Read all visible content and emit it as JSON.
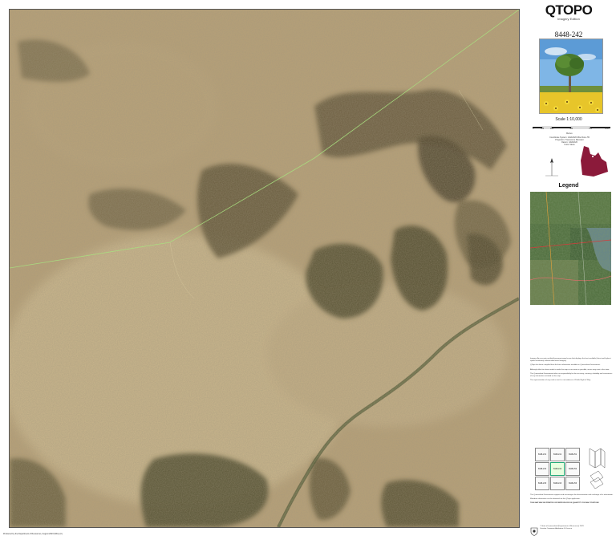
{
  "panel": {
    "title": "QTOPO",
    "edition": "Imagery Edition",
    "sheet": "8448-242",
    "scale": "Scale 1:10,000",
    "scale_ticks": [
      "0",
      "125",
      "250",
      "500",
      "750",
      "1000"
    ],
    "scale_unit": "Metres",
    "projection": [
      "Coordinate System: GDA2020 MGA Zone 55",
      "Projection: Transverse Mercator",
      "Datum: GDA2020",
      "Units: Metre"
    ],
    "legend_title": "Legend",
    "notes": [
      "Imagery: An accurate rectified basemap image/scene that displays the best available (latest and highest spatial resolution) orthorectified aerial imagery.",
      "QTopo has been compiled from the best information available in Queensland Government.",
      "Although effort has been made to make the map as accurate as possible, errors may exist in this data.",
      "The Queensland Government takes no responsibility for the accuracy, currency, reliability and correctness of any information included on the map.",
      "The representation of any road or track is not evidence of Public Right of Way."
    ],
    "footer_notes": [
      "The Queensland Government supports and encourages the dissemination and exchange of its information.",
      "Metadata information can be obtained via the QTopo application.",
      "THIS MAP MAY BE PRINTED OR REPRODUCED IN QUANTITY FOR ANY PURPOSE"
    ],
    "copyright": [
      "© State of Queensland (Department of Resources) 2023",
      "Creative Commons Attribution 4.0 licence"
    ],
    "index": {
      "rows": [
        [
          "8448-231",
          "8448-241",
          "8448-251"
        ],
        [
          "8448-232",
          "8448-242",
          "8448-252"
        ],
        [
          "8448-233",
          "8448-243",
          "8448-253"
        ]
      ],
      "current": "8448-242"
    }
  },
  "map": {
    "credit": "Produced by the Department of Resources, August 2023 (Mbx) (V)"
  },
  "colors": {
    "terrain_light": "#c2ad84",
    "terrain_dark": "#5d5236",
    "vegetation": "#4f4a2c",
    "boundary_line": "#a9e07f",
    "state_map": "#8b1a3a"
  }
}
